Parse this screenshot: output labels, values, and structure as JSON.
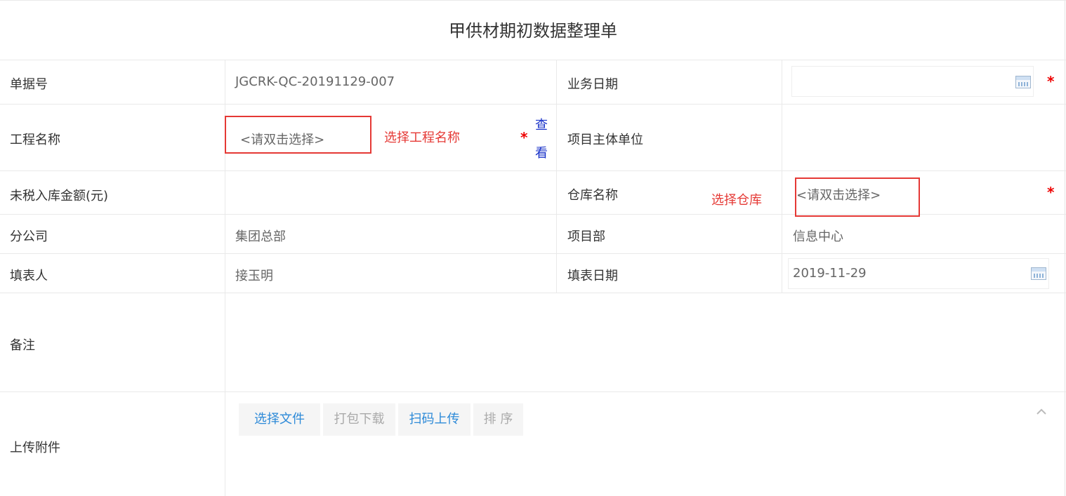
{
  "form": {
    "title": "甲供材期初数据整理单",
    "rows": {
      "doc_no_label": "单据号",
      "doc_no_value": "JGCRK-QC-20191129-007",
      "biz_date_label": "业务日期",
      "project_name_label": "工程名称",
      "project_name_placeholder": "<请双击选择>",
      "project_name_annotation": "选择工程名称",
      "view_link_line1": "查",
      "view_link_line2": "看",
      "project_owner_label": "项目主体单位",
      "untaxed_amount_label": "未税入库金额(元)",
      "warehouse_label": "仓库名称",
      "warehouse_annotation": "选择仓库",
      "warehouse_placeholder": "<请双击选择>",
      "branch_label": "分公司",
      "branch_value": "集团总部",
      "dept_label": "项目部",
      "dept_value": "信息中心",
      "filler_label": "填表人",
      "filler_value": "接玉明",
      "fill_date_label": "填表日期",
      "fill_date_value": "2019-11-29",
      "remark_label": "备注",
      "attachment_label": "上传附件"
    },
    "required_mark": "*",
    "attachment_buttons": {
      "select_file": "选择文件",
      "pack_download": "打包下载",
      "scan_upload": "扫码上传",
      "sort": "排 序"
    }
  }
}
